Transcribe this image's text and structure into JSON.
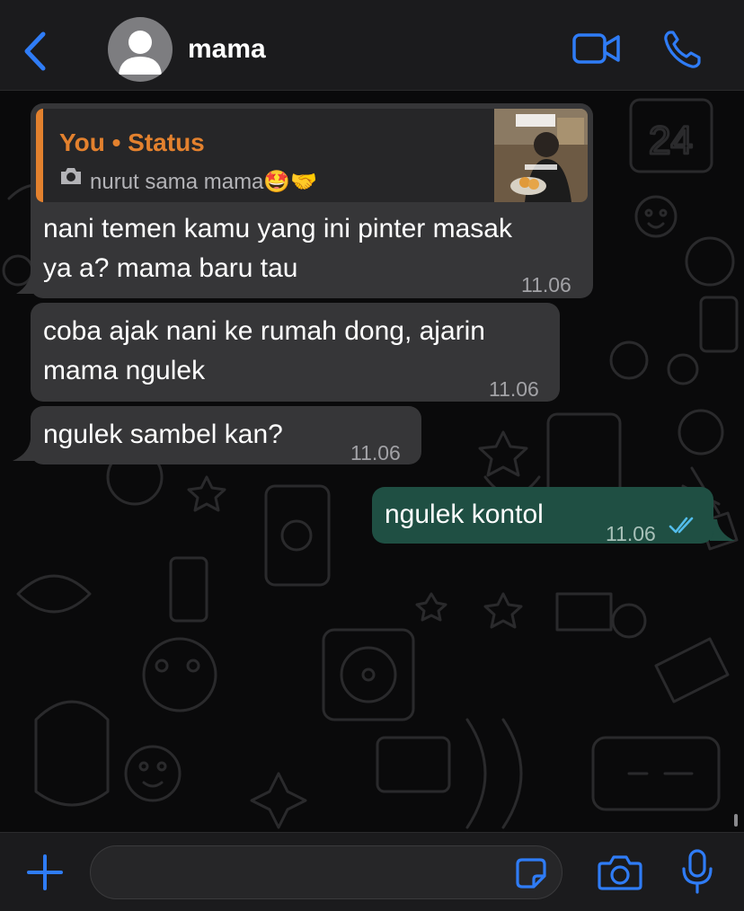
{
  "colors": {
    "accent": "#2f7cf6",
    "incoming_bubble": "#363638",
    "outgoing_bubble": "#1f4f43",
    "quote_author": "#e3812e",
    "read_ticks": "#53bdeb"
  },
  "header": {
    "contact_name": "mama",
    "back_icon": "chevron-left-icon",
    "avatar_icon": "person-avatar-icon",
    "video_icon": "video-camera-icon",
    "call_icon": "phone-icon"
  },
  "messages": [
    {
      "direction": "incoming",
      "reply": {
        "author": "You • Status",
        "caption": "nurut sama mama🤩🤝",
        "caption_icon": "camera-icon",
        "thumbnail_icon": "status-thumbnail-image"
      },
      "text_lines": [
        "nani temen kamu yang ini pinter masak",
        "ya a? mama baru tau"
      ],
      "time": "11.06"
    },
    {
      "direction": "incoming",
      "text_lines": [
        "coba ajak nani ke rumah dong, ajarin",
        "mama ngulek"
      ],
      "time": "11.06"
    },
    {
      "direction": "incoming",
      "text_lines": [
        "ngulek sambel kan?"
      ],
      "time": "11.06"
    },
    {
      "direction": "outgoing",
      "text_lines": [
        "ngulek kontol"
      ],
      "time": "11.06",
      "status_icon": "double-check-read-icon"
    }
  ],
  "input": {
    "placeholder": "",
    "plus_icon": "plus-icon",
    "sticker_icon": "sticker-icon",
    "camera_icon": "camera-icon",
    "mic_icon": "microphone-icon"
  }
}
